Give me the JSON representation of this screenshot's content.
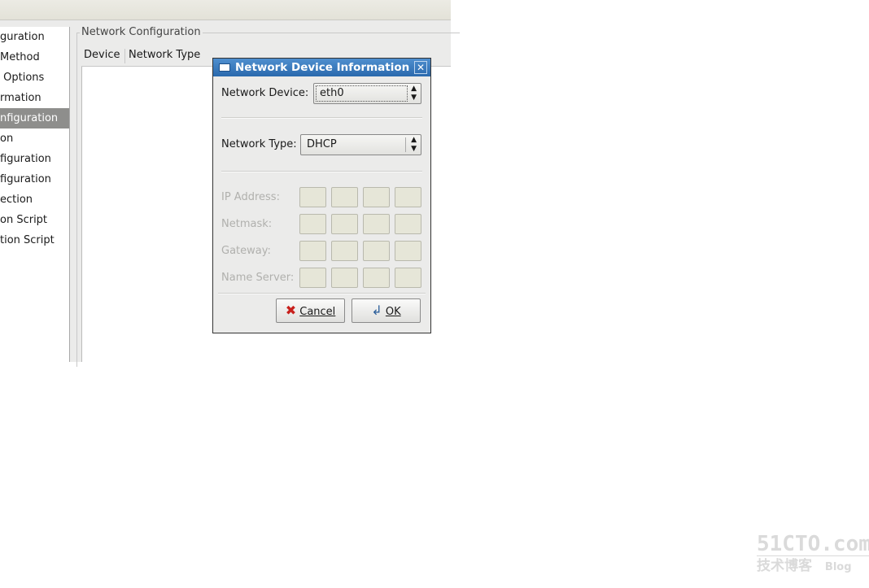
{
  "sidebar": {
    "items": [
      {
        "label": "guration",
        "selected": false
      },
      {
        "label": "Method",
        "selected": false
      },
      {
        "label": " Options",
        "selected": false
      },
      {
        "label": "rmation",
        "selected": false
      },
      {
        "label": "nfiguration",
        "selected": true
      },
      {
        "label": "on",
        "selected": false
      },
      {
        "label": "figuration",
        "selected": false
      },
      {
        "label": "figuration",
        "selected": false
      },
      {
        "label": "ection",
        "selected": false
      },
      {
        "label": "on Script",
        "selected": false
      },
      {
        "label": "tion Script",
        "selected": false
      }
    ]
  },
  "main": {
    "frame_label": "Network Configuration",
    "columns": [
      "Device",
      "Network Type"
    ]
  },
  "dialog": {
    "title": "Network Device Information",
    "device_label": "Network Device:",
    "device_value": "eth0",
    "type_label": "Network Type:",
    "type_value": "DHCP",
    "fields": [
      "IP Address:",
      "Netmask:",
      "Gateway:",
      "Name Server:"
    ],
    "cancel_label": "Cancel",
    "ok_label": "OK"
  },
  "watermark": {
    "line1": "51CTO.com",
    "line2": "技术博客",
    "line3": "Blog"
  },
  "colors": {
    "title_bar": "#2a69ad",
    "selected_item": "#8e8e8c"
  }
}
